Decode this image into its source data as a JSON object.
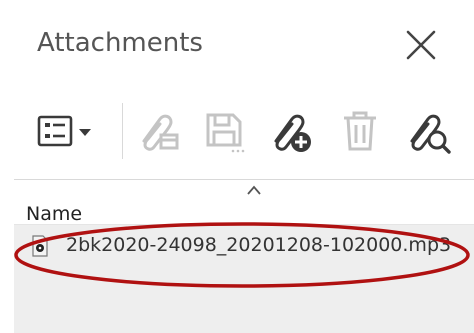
{
  "panel": {
    "title": "Attachments"
  },
  "toolbar": {
    "buttons": [
      {
        "name": "view-options",
        "icon": "list-view-dropdown-icon",
        "enabled": true
      },
      {
        "name": "open-attachment",
        "icon": "paperclip-open-icon",
        "enabled": false
      },
      {
        "name": "save-attachment",
        "icon": "floppy-disk-icon",
        "enabled": false
      },
      {
        "name": "add-attachment",
        "icon": "paperclip-add-icon",
        "enabled": true
      },
      {
        "name": "delete-attachment",
        "icon": "trash-icon",
        "enabled": false
      },
      {
        "name": "search-attachment",
        "icon": "paperclip-search-icon",
        "enabled": true
      }
    ]
  },
  "list": {
    "columns": [
      {
        "label": "Name",
        "sorted": "ascending"
      }
    ],
    "rows": [
      {
        "file_name": "2bk2020-24098_20201208-102000.mp3",
        "icon": "audio-file-icon"
      }
    ]
  },
  "annotation": {
    "highlight_color": "#b01111"
  },
  "colors": {
    "icon_enabled": "#3a3a3a",
    "icon_disabled": "#c4c4c4",
    "list_background": "#eeeeee"
  }
}
